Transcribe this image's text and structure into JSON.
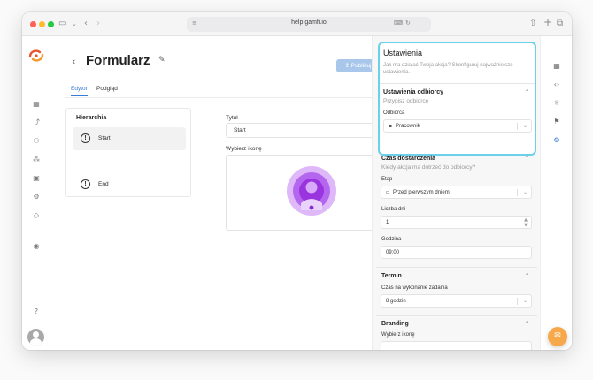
{
  "browser": {
    "url": "help.gamfi.io",
    "icons": [
      "sidebar-icon",
      "chevron-down-icon",
      "back-icon",
      "forward-icon",
      "share-icon",
      "new-tab-icon",
      "tabs-icon"
    ]
  },
  "left_nav": {
    "icons": [
      "dashboard-icon",
      "flow-icon",
      "users-icon",
      "groups-icon",
      "clipboard-icon",
      "settings-icon",
      "tag-icon",
      "user-circle-icon",
      "help-icon"
    ]
  },
  "header": {
    "back_symbol": "‹",
    "title": "Formularz",
    "edit_symbol": "✎",
    "publish_label": "↥ Publikuj"
  },
  "tabs": [
    {
      "label": "Edytor",
      "active": true
    },
    {
      "label": "Podgląd",
      "active": false
    }
  ],
  "hierarchy": {
    "title": "Hierarchia",
    "nodes": [
      {
        "label": "Start",
        "symbol": "!",
        "selected": true
      },
      {
        "label": "End",
        "symbol": "!",
        "selected": false
      }
    ]
  },
  "form": {
    "title_label": "Tytuł",
    "title_value": "Start",
    "icon_label": "Wybierz ikonę"
  },
  "settings": {
    "title": "Ustawienia",
    "subtitle": "Jak ma działać Twoja akcja? Skonfiguruj najważniejsze ustawienia.",
    "recipients": {
      "title": "Ustawienia odbiorcy",
      "note": "Przypisz odbiorcę",
      "field_label": "Odbiorca",
      "value": "Pracownik"
    },
    "delivery": {
      "title": "Czas dostarczenia",
      "note": "Kiedy akcja ma dotrzeć do odbiorcy?",
      "stage_label": "Etap",
      "stage_value": "Przed pierwszym dniem",
      "days_label": "Liczba dni",
      "days_value": "1",
      "time_label": "Godzina",
      "time_value": "09:00"
    },
    "deadline": {
      "title": "Termin",
      "field_label": "Czas na wykonanie zadania",
      "value": "8 godzin"
    },
    "branding": {
      "title": "Branding",
      "icon_label": "Wybierz ikonę"
    }
  },
  "right_rail": {
    "icons": [
      "grid-icon",
      "code-icon",
      "bug-icon",
      "flag-icon",
      "settings-icon"
    ]
  },
  "colors": {
    "accent": "#3a7bd5",
    "publish_disabled": "#a9c7ea",
    "highlight": "#6ad1e8",
    "purple": "#a13ee0",
    "chat": "#f6a84b"
  }
}
